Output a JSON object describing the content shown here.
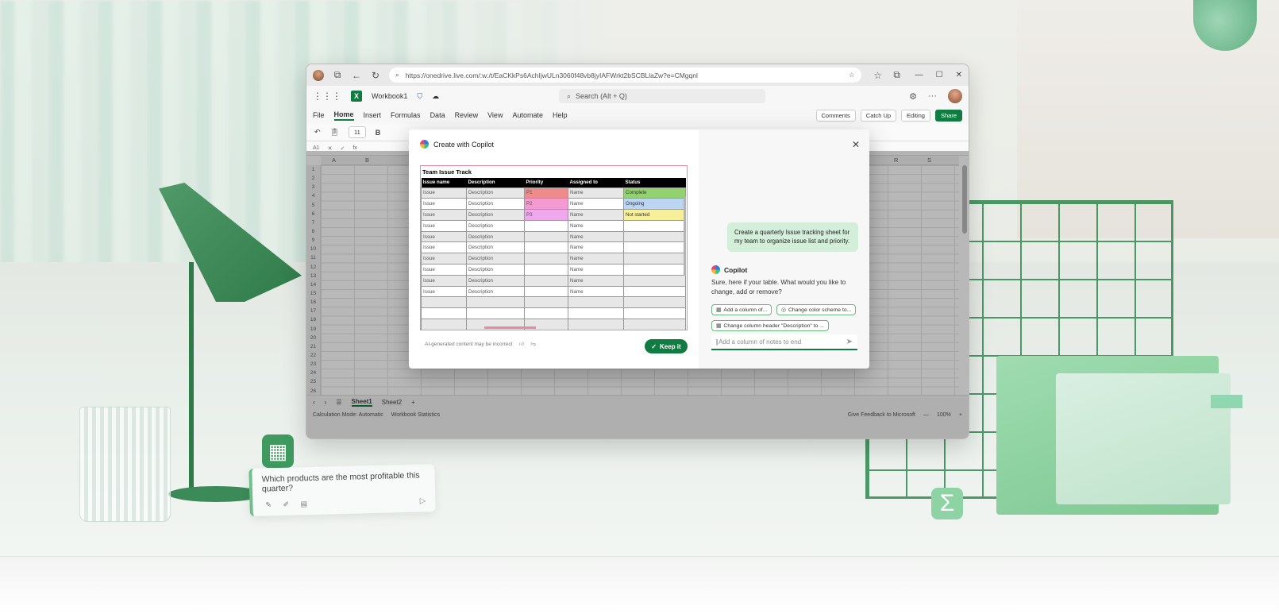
{
  "browser": {
    "url": "https://onedrive.live.com/:w:/t/EaCKkPs6AchIjwULn3060f48vb8jyIAFWrkt2bSCBLlaZw?e=CMgqnl"
  },
  "app": {
    "workbook_name": "Workbook1",
    "search_placeholder": "Search (Alt + Q)",
    "menus": [
      "File",
      "Home",
      "Insert",
      "Formulas",
      "Data",
      "Review",
      "View",
      "Automate",
      "Help"
    ],
    "active_menu": "Home",
    "comments_label": "Comments",
    "catchup_label": "Catch Up",
    "editing_label": "Editing",
    "share_label": "Share",
    "font_size": "11",
    "name_box": "A1",
    "fx_label": "fx",
    "columns": [
      "A",
      "B",
      "Q",
      "R",
      "S"
    ],
    "rows": [
      "1",
      "2",
      "3",
      "4",
      "5",
      "6",
      "7",
      "8",
      "9",
      "10",
      "11",
      "12",
      "13",
      "14",
      "15",
      "16",
      "17",
      "18",
      "19",
      "20",
      "21",
      "22",
      "23",
      "24",
      "25",
      "26"
    ],
    "sheets": [
      "Sheet1",
      "Sheet2"
    ],
    "add_sheet": "+",
    "status_left": [
      "Calculation Mode: Automatic",
      "Workbook Statistics"
    ],
    "status_right": [
      "Give Feedback to Microsoft",
      "100%"
    ]
  },
  "dialog": {
    "title": "Create with Copilot",
    "preview_title": "Team Issue Track",
    "headers": [
      "Issue name",
      "Description",
      "Priority",
      "Assigned to",
      "Status"
    ],
    "rows": [
      [
        "Issue",
        "Description",
        "P1",
        "Name",
        "Complete"
      ],
      [
        "Issue",
        "Description",
        "P2",
        "Name",
        "Ongoing"
      ],
      [
        "Issue",
        "Description",
        "P3",
        "Name",
        "Not started"
      ],
      [
        "Issue",
        "Description",
        "",
        "Name",
        ""
      ],
      [
        "Issue",
        "Description",
        "",
        "Name",
        ""
      ],
      [
        "Issue",
        "Description",
        "",
        "Name",
        ""
      ],
      [
        "Issue",
        "Description",
        "",
        "Name",
        ""
      ],
      [
        "Issue",
        "Description",
        "",
        "Name",
        ""
      ],
      [
        "Issue",
        "Description",
        "",
        "Name",
        ""
      ],
      [
        "Issue",
        "Description",
        "",
        "Name",
        ""
      ],
      [
        "",
        "",
        "",
        "",
        ""
      ],
      [
        "",
        "",
        "",
        "",
        ""
      ],
      [
        "",
        "",
        "",
        "",
        ""
      ]
    ],
    "priority_colors": {
      "P1": "#ef8b8b",
      "P2": "#f39ad1",
      "P3": "#f0a8ec"
    },
    "status_colors": {
      "Complete": "#92d36e",
      "Ongoing": "#bcd5f2",
      "Not started": "#f8ef9a"
    },
    "disclaimer": "AI-generated content may be incorrect",
    "keep_label": "Keep it",
    "user_message": "Create a quarterly Issue tracking sheet for my team to organize issue list and priority.",
    "assistant_name": "Copilot",
    "assistant_reply": "Sure, here if your table. What would you like to change, add or remove?",
    "suggestions": [
      "Add a column of...",
      "Change color scheme to...",
      "Change column header \"Description\" to ..."
    ],
    "input_placeholder": "Add a column of notes to end"
  },
  "scene": {
    "prompt_card_text": "Which products are the most profitable this quarter?",
    "sigma_glyph": "Σ",
    "grid_glyph": "▦"
  },
  "colors": {
    "excel_green": "#107c41",
    "copilot_bubble": "#d3efd9",
    "chip_border": "#6cb882"
  }
}
